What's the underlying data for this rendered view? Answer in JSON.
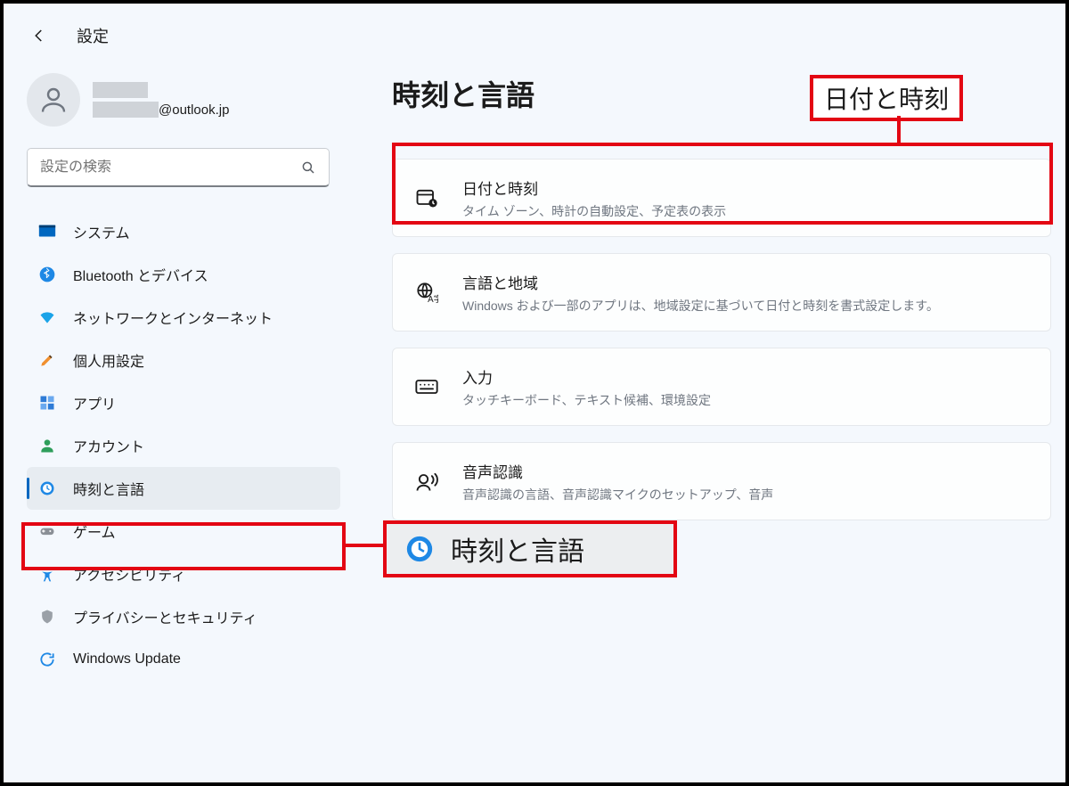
{
  "header": {
    "app_title": "設定"
  },
  "account": {
    "email_visible": "@outlook.jp"
  },
  "search": {
    "placeholder": "設定の検索"
  },
  "nav": {
    "items": [
      {
        "label": "システム"
      },
      {
        "label": "Bluetooth とデバイス"
      },
      {
        "label": "ネットワークとインターネット"
      },
      {
        "label": "個人用設定"
      },
      {
        "label": "アプリ"
      },
      {
        "label": "アカウント"
      },
      {
        "label": "時刻と言語"
      },
      {
        "label": "ゲーム"
      },
      {
        "label": "アクセシビリティ"
      },
      {
        "label": "プライバシーとセキュリティ"
      },
      {
        "label": "Windows Update"
      }
    ],
    "selected_index": 6
  },
  "main": {
    "title": "時刻と言語",
    "cards": [
      {
        "title": "日付と時刻",
        "desc": "タイム ゾーン、時計の自動設定、予定表の表示"
      },
      {
        "title": "言語と地域",
        "desc": "Windows および一部のアプリは、地域設定に基づいて日付と時刻を書式設定します。"
      },
      {
        "title": "入力",
        "desc": "タッチキーボード、テキスト候補、環境設定"
      },
      {
        "title": "音声認識",
        "desc": "音声認識の言語、音声認識マイクのセットアップ、音声"
      }
    ]
  },
  "annotations": {
    "top_label": "日付と時刻",
    "big_callout_text": "時刻と言語"
  }
}
